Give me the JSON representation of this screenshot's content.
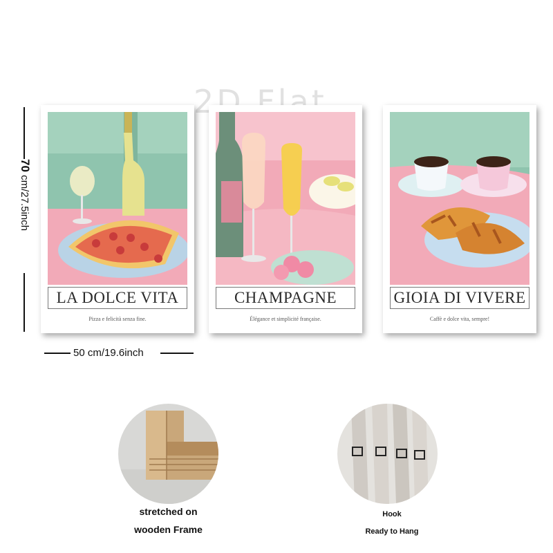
{
  "watermark": "2D Flat",
  "dimensions": {
    "height_label_big": "70",
    "height_label_rest": "cm/27.5inch",
    "width_label": "50 cm/19.6inch"
  },
  "posters": [
    {
      "title": "LA DOLCE VITA",
      "subtitle": "Pizza e felicità senza fine."
    },
    {
      "title": "CHAMPAGNE",
      "subtitle": "Élégance et simplicité française."
    },
    {
      "title": "GIOIA DI VIVERE",
      "subtitle": "Caffè e dolce vita, sempre!"
    }
  ],
  "features": [
    {
      "line1": "stretched on",
      "line2": "wooden Frame"
    },
    {
      "line1": "Hook",
      "line2": "Ready to Hang"
    }
  ],
  "colors": {
    "mint": "#8fc4ae",
    "pink": "#f2aab8",
    "cream": "#fbf6e8"
  }
}
